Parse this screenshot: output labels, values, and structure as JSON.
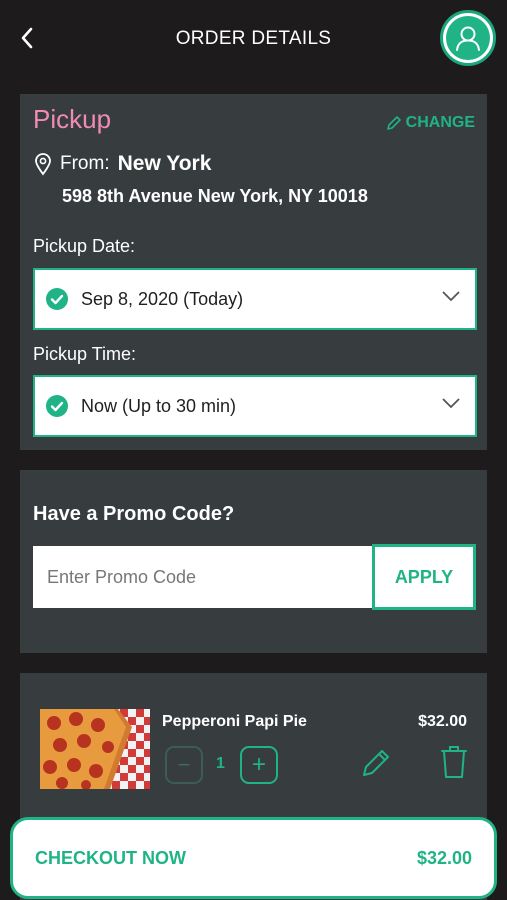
{
  "header": {
    "title": "ORDER DETAILS",
    "back_icon": "chevron-left-icon",
    "avatar_icon": "user-icon"
  },
  "pickup": {
    "title": "Pickup",
    "change_label": "CHANGE",
    "from_label": "From:",
    "city": "New York",
    "address": "598 8th Avenue New York, NY 10018",
    "date_label": "Pickup Date:",
    "date_value": "Sep 8, 2020 (Today)",
    "time_label": "Pickup Time:",
    "time_value": "Now (Up to 30 min)"
  },
  "promo": {
    "heading": "Have a Promo Code?",
    "placeholder": "Enter Promo Code",
    "apply_label": "APPLY"
  },
  "cart": {
    "items": [
      {
        "name": "Pepperoni Papi Pie",
        "price": "$32.00",
        "quantity": "1",
        "minus": "−",
        "plus": "+"
      }
    ]
  },
  "checkout": {
    "label": "CHECKOUT NOW",
    "total": "$32.00"
  },
  "colors": {
    "accent": "#1fb385",
    "pickup_title": "#f08cb4",
    "card_bg": "#373d3f",
    "page_bg": "#1d1b1b"
  }
}
